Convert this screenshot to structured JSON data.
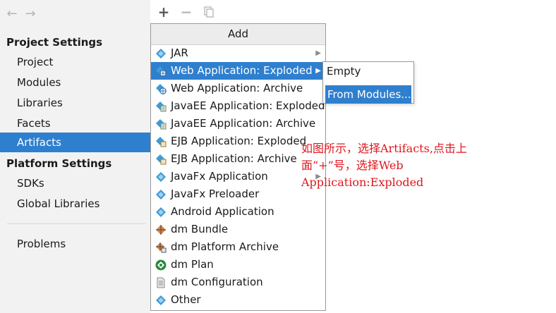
{
  "nav": {
    "back_glyph": "←",
    "forward_glyph": "→"
  },
  "sidebar": {
    "project_settings_header": "Project Settings",
    "project_items": [
      "Project",
      "Modules",
      "Libraries",
      "Facets",
      "Artifacts"
    ],
    "selected": "Artifacts",
    "platform_settings_header": "Platform Settings",
    "platform_items": [
      "SDKs",
      "Global Libraries"
    ],
    "other_items": [
      "Problems"
    ]
  },
  "toolbar": {
    "add_glyph": "+",
    "remove_glyph": "−",
    "copy_icon": "copy-icon"
  },
  "add_menu": {
    "header": "Add",
    "items": [
      {
        "label": "JAR",
        "icon": "jar-icon",
        "has_submenu": true
      },
      {
        "label": "Web Application: Exploded",
        "icon": "web-app-icon",
        "has_submenu": true,
        "highlighted": true
      },
      {
        "label": "Web Application: Archive",
        "icon": "web-app-icon"
      },
      {
        "label": "JavaEE Application: Exploded",
        "icon": "javaee-icon"
      },
      {
        "label": "JavaEE Application: Archive",
        "icon": "javaee-icon"
      },
      {
        "label": "EJB Application: Exploded",
        "icon": "ejb-icon"
      },
      {
        "label": "EJB Application: Archive",
        "icon": "ejb-icon"
      },
      {
        "label": "JavaFx Application",
        "icon": "javafx-icon",
        "has_submenu": true
      },
      {
        "label": "JavaFx Preloader",
        "icon": "javafx-icon"
      },
      {
        "label": "Android Application",
        "icon": "android-icon"
      },
      {
        "label": "dm Bundle",
        "icon": "dm-bundle-icon"
      },
      {
        "label": "dm Platform Archive",
        "icon": "dm-archive-icon"
      },
      {
        "label": "dm Plan",
        "icon": "dm-plan-icon"
      },
      {
        "label": "dm Configuration",
        "icon": "file-icon"
      },
      {
        "label": "Other",
        "icon": "other-icon"
      }
    ]
  },
  "sub_menu": {
    "items": [
      "Empty",
      "From Modules..."
    ],
    "selected": "From Modules..."
  },
  "annotation": {
    "line1": "如图所示，选择Artifacts,点击上",
    "line2": "面“+”号，选择Web",
    "line3": "Application:Exploded"
  },
  "colors": {
    "selection": "#2f7fcf",
    "annotation": "#e0161d",
    "icon_blue": "#3d9bd6"
  }
}
